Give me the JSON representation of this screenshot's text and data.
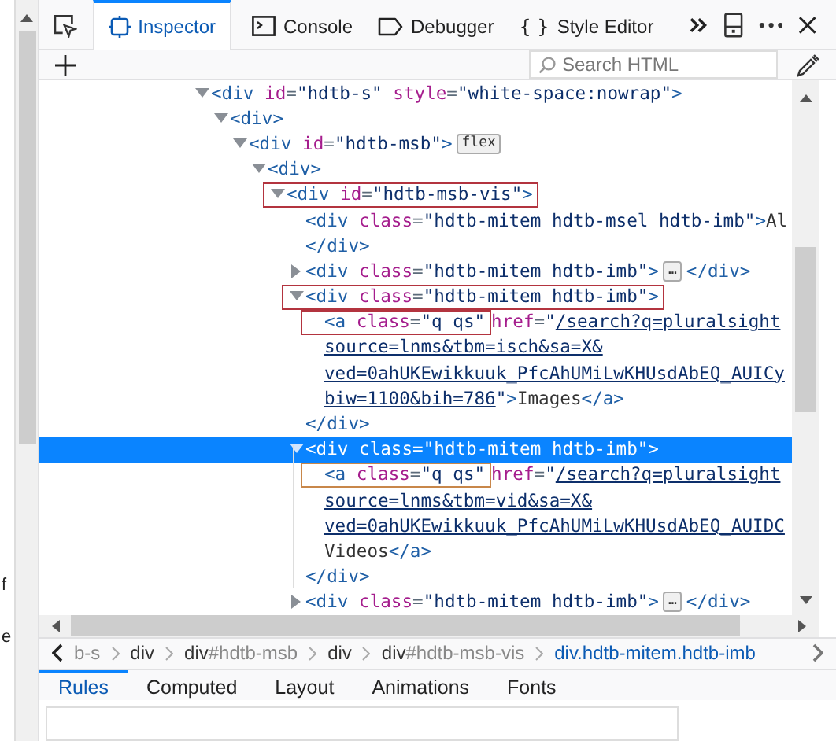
{
  "page_fragments": [
    "f",
    "e"
  ],
  "toolbar": {
    "tabs": [
      {
        "label": "Inspector",
        "kind": "inspector",
        "selected": true
      },
      {
        "label": "Console",
        "kind": "console",
        "selected": false
      },
      {
        "label": "Debugger",
        "kind": "debugger",
        "selected": false
      },
      {
        "label": "Style Editor",
        "kind": "style-editor",
        "icon_text": "{ }",
        "selected": false
      }
    ]
  },
  "search": {
    "placeholder": "Search HTML"
  },
  "markup": {
    "nodes": [
      {
        "selected": false,
        "expanded": true,
        "lines": [
          {
            "tokens": [
              {
                "kind": "tag",
                "text": "<div"
              },
              {
                "kind": "attr",
                "text": " id"
              },
              {
                "kind": "eq",
                "text": "="
              },
              {
                "kind": "val",
                "text": "\"hdtb-s\""
              },
              {
                "kind": "attr",
                "text": " style"
              },
              {
                "kind": "eq",
                "text": "="
              },
              {
                "kind": "val",
                "text": "\"white-space:nowrap\""
              },
              {
                "kind": "tag",
                "text": ">"
              }
            ]
          }
        ],
        "children": [
          {
            "selected": false,
            "expanded": true,
            "lines": [
              {
                "tokens": [
                  {
                    "kind": "tag",
                    "text": "<div>"
                  }
                ]
              }
            ],
            "children": [
              {
                "selected": false,
                "expanded": true,
                "lines": [
                  {
                    "tokens": [
                      {
                        "kind": "tag",
                        "text": "<div"
                      },
                      {
                        "kind": "attr",
                        "text": " id"
                      },
                      {
                        "kind": "eq",
                        "text": "="
                      },
                      {
                        "kind": "val",
                        "text": "\"hdtb-msb\""
                      },
                      {
                        "kind": "tag",
                        "text": ">"
                      }
                    ],
                    "badge": "flex"
                  }
                ],
                "children": [
                  {
                    "selected": false,
                    "expanded": true,
                    "lines": [
                      {
                        "tokens": [
                          {
                            "kind": "tag",
                            "text": "<div>"
                          }
                        ]
                      }
                    ],
                    "children": [
                      {
                        "selected": false,
                        "expanded": true,
                        "color": "#b3343f",
                        "lines": [
                          {
                            "boxed": [
                              {
                                "kind": "tag",
                                "text": "<div"
                              },
                              {
                                "kind": "attr",
                                "text": " id"
                              },
                              {
                                "kind": "eq",
                                "text": "="
                              },
                              {
                                "kind": "val",
                                "text": "\"hdtb-msb-vis\""
                              },
                              {
                                "kind": "tag",
                                "text": ">"
                              }
                            ]
                          }
                        ],
                        "children": [
                          {
                            "selected": false,
                            "lines": [
                              {
                                "tokens": [
                                  {
                                    "kind": "tag",
                                    "text": "<div"
                                  },
                                  {
                                    "kind": "attr",
                                    "text": " class"
                                  },
                                  {
                                    "kind": "eq",
                                    "text": "="
                                  },
                                  {
                                    "kind": "val",
                                    "text": "\"hdtb-mitem hdtb-msel hdtb-imb\""
                                  },
                                  {
                                    "kind": "tag",
                                    "text": ">"
                                  },
                                  {
                                    "kind": "text",
                                    "text": "Al"
                                  }
                                ]
                              }
                            ],
                            "close": [
                              {
                                "kind": "tag",
                                "text": "</div>"
                              }
                            ]
                          },
                          {
                            "selected": false,
                            "expanded": false,
                            "lines": [
                              {
                                "tokens": [
                                  {
                                    "kind": "tag",
                                    "text": "<div"
                                  },
                                  {
                                    "kind": "attr",
                                    "text": " class"
                                  },
                                  {
                                    "kind": "eq",
                                    "text": "="
                                  },
                                  {
                                    "kind": "val",
                                    "text": "\"hdtb-mitem hdtb-imb\""
                                  },
                                  {
                                    "kind": "tag",
                                    "text": ">"
                                  }
                                ],
                                "badge": "…",
                                "after": [
                                  {
                                    "kind": "tag",
                                    "text": "</div>"
                                  }
                                ]
                              }
                            ]
                          },
                          {
                            "selected": false,
                            "expanded": true,
                            "color": "#b3343f",
                            "lines": [
                              {
                                "boxed": [
                                  {
                                    "kind": "tag",
                                    "text": "<div"
                                  },
                                  {
                                    "kind": "attr",
                                    "text": " class"
                                  },
                                  {
                                    "kind": "eq",
                                    "text": "="
                                  },
                                  {
                                    "kind": "val",
                                    "text": "\"hdtb-mitem hdtb-imb\""
                                  },
                                  {
                                    "kind": "tag",
                                    "text": ">"
                                  }
                                ]
                              }
                            ],
                            "close": [
                              {
                                "kind": "tag",
                                "text": "</div>"
                              }
                            ],
                            "children": [
                              {
                                "selected": false,
                                "color": "#b3343f",
                                "lines": [
                                  {
                                    "boxed": [
                                      {
                                        "kind": "tag",
                                        "text": "<a"
                                      },
                                      {
                                        "kind": "attr",
                                        "text": " class"
                                      },
                                      {
                                        "kind": "eq",
                                        "text": "="
                                      },
                                      {
                                        "kind": "val",
                                        "text": "\"q qs\""
                                      }
                                    ],
                                    "tokens": [
                                      {
                                        "kind": "attr",
                                        "text": " href"
                                      },
                                      {
                                        "kind": "eq",
                                        "text": "="
                                      },
                                      {
                                        "kind": "val",
                                        "text": "\""
                                      },
                                      {
                                        "kind": "link",
                                        "text": "/search?q=pluralsight"
                                      }
                                    ]
                                  },
                                  {
                                    "tokens": [
                                      {
                                        "kind": "link",
                                        "text": "source=lnms&tbm=isch&sa=X&"
                                      }
                                    ]
                                  },
                                  {
                                    "tokens": [
                                      {
                                        "kind": "link",
                                        "text": "ved=0ahUKEwikkuuk_PfcAhUMiLwKHUsdAbEQ_AUICy"
                                      }
                                    ]
                                  },
                                  {
                                    "tokens": [
                                      {
                                        "kind": "link",
                                        "text": "biw=1100&bih=786"
                                      },
                                      {
                                        "kind": "val",
                                        "text": "\""
                                      },
                                      {
                                        "kind": "tag",
                                        "text": ">"
                                      },
                                      {
                                        "kind": "text",
                                        "text": "Images"
                                      },
                                      {
                                        "kind": "tag",
                                        "text": "</a>"
                                      }
                                    ]
                                  }
                                ]
                              }
                            ]
                          },
                          {
                            "selected": true,
                            "expanded": true,
                            "lines": [
                              {
                                "tokens": [
                                  {
                                    "kind": "tag",
                                    "text": "<div"
                                  },
                                  {
                                    "kind": "attr",
                                    "text": " class"
                                  },
                                  {
                                    "kind": "eq",
                                    "text": "="
                                  },
                                  {
                                    "kind": "val",
                                    "text": "\"hdtb-mitem hdtb-imb\""
                                  },
                                  {
                                    "kind": "tag",
                                    "text": ">"
                                  }
                                ]
                              }
                            ],
                            "close": [
                              {
                                "kind": "tag",
                                "text": "</div>"
                              }
                            ],
                            "children": [
                              {
                                "selected": false,
                                "color": "#c8874a",
                                "lines": [
                                  {
                                    "boxed": [
                                      {
                                        "kind": "tag",
                                        "text": "<a"
                                      },
                                      {
                                        "kind": "attr",
                                        "text": " class"
                                      },
                                      {
                                        "kind": "eq",
                                        "text": "="
                                      },
                                      {
                                        "kind": "val",
                                        "text": "\"q qs\""
                                      }
                                    ],
                                    "tokens": [
                                      {
                                        "kind": "attr",
                                        "text": " href"
                                      },
                                      {
                                        "kind": "eq",
                                        "text": "="
                                      },
                                      {
                                        "kind": "val",
                                        "text": "\""
                                      },
                                      {
                                        "kind": "link",
                                        "text": "/search?q=pluralsight"
                                      }
                                    ]
                                  },
                                  {
                                    "tokens": [
                                      {
                                        "kind": "link",
                                        "text": "source=lnms&tbm=vid&sa=X&"
                                      }
                                    ]
                                  },
                                  {
                                    "tokens": [
                                      {
                                        "kind": "link",
                                        "text": "ved=0ahUKEwikkuuk_PfcAhUMiLwKHUsdAbEQ_AUIDC"
                                      }
                                    ]
                                  },
                                  {
                                    "tokens": [
                                      {
                                        "kind": "text",
                                        "text": "Videos"
                                      },
                                      {
                                        "kind": "tag",
                                        "text": "</a>"
                                      }
                                    ]
                                  }
                                ]
                              }
                            ]
                          },
                          {
                            "selected": false,
                            "expanded": false,
                            "lines": [
                              {
                                "tokens": [
                                  {
                                    "kind": "tag",
                                    "text": "<div"
                                  },
                                  {
                                    "kind": "attr",
                                    "text": " class"
                                  },
                                  {
                                    "kind": "eq",
                                    "text": "="
                                  },
                                  {
                                    "kind": "val",
                                    "text": "\"hdtb-mitem hdtb-imb\""
                                  },
                                  {
                                    "kind": "tag",
                                    "text": ">"
                                  }
                                ],
                                "badge": "…",
                                "after": [
                                  {
                                    "kind": "tag",
                                    "text": "</div>"
                                  }
                                ]
                              }
                            ]
                          }
                        ]
                      }
                    ]
                  }
                ]
              }
            ]
          }
        ]
      }
    ]
  },
  "breadcrumbs": [
    {
      "rest": "b-s",
      "selected": false
    },
    {
      "tag": "div",
      "selected": false
    },
    {
      "tag": "div",
      "rest": "#hdtb-msb",
      "selected": false
    },
    {
      "tag": "div",
      "selected": false
    },
    {
      "tag": "div",
      "rest": "#hdtb-msb-vis",
      "selected": false
    },
    {
      "tag": "div.hdtb-mitem.hdtb-imb",
      "selected": true
    }
  ],
  "side_tabs": [
    {
      "label": "Rules",
      "selected": true
    },
    {
      "label": "Computed",
      "selected": false
    },
    {
      "label": "Layout",
      "selected": false
    },
    {
      "label": "Animations",
      "selected": false
    },
    {
      "label": "Fonts",
      "selected": false
    }
  ]
}
